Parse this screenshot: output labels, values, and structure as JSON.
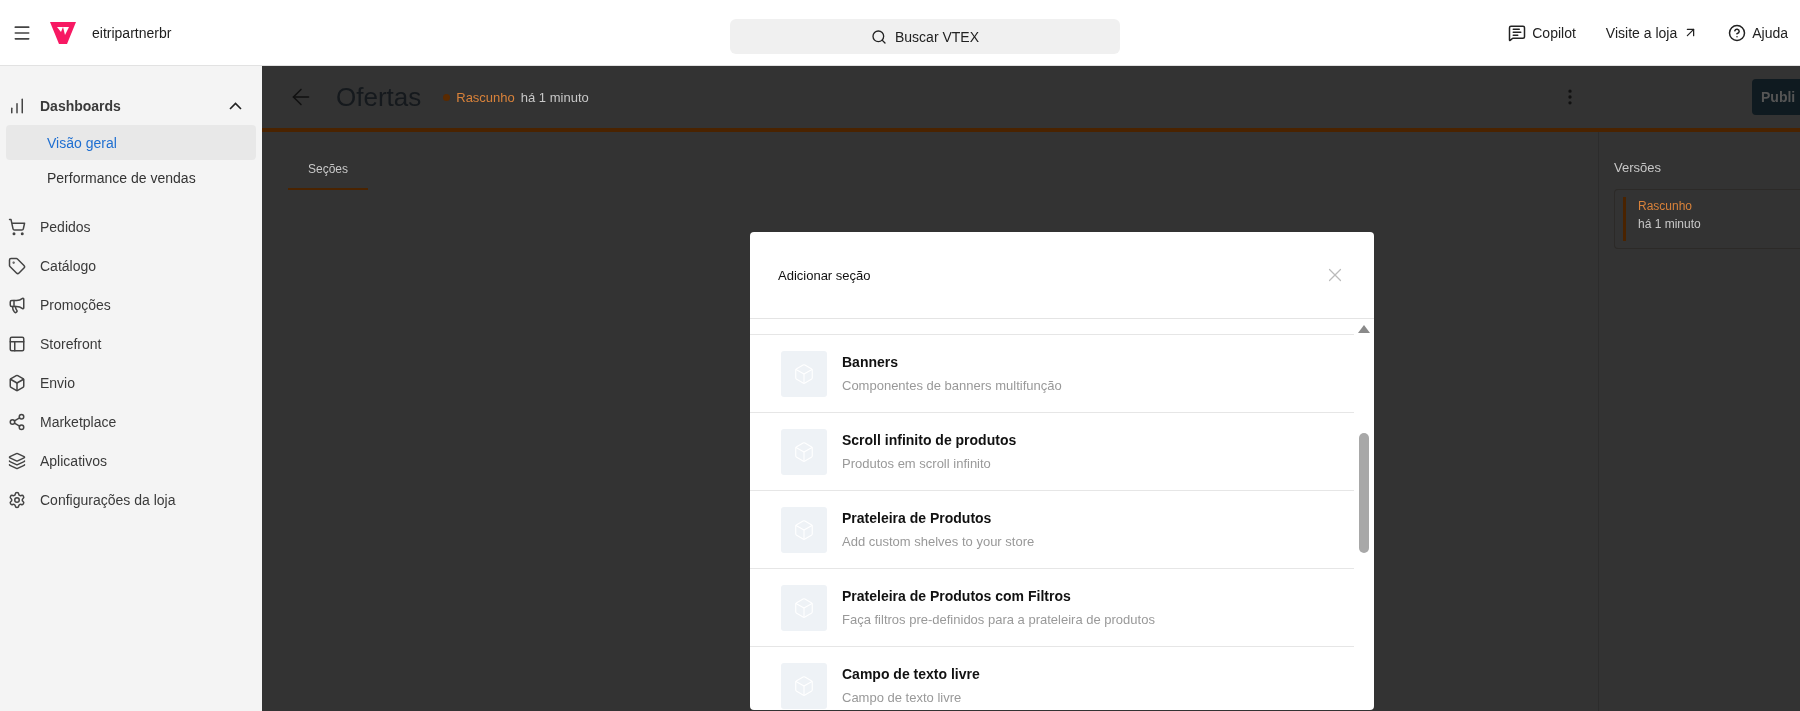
{
  "topbar": {
    "brand": "eitripartnerbr",
    "search": {
      "placeholder": "Buscar VTEX"
    },
    "actions": [
      {
        "label": "Copilot",
        "kind": "chat"
      },
      {
        "label": "Visite a loja",
        "kind": "external"
      },
      {
        "label": "Ajuda",
        "kind": "help"
      }
    ]
  },
  "sidebar": {
    "items": [
      {
        "label": "Dashboards",
        "expanded": true,
        "children": [
          {
            "label": "Visão geral",
            "selected": true
          },
          {
            "label": "Performance de vendas",
            "selected": false
          }
        ]
      },
      {
        "label": "Pedidos"
      },
      {
        "label": "Catálogo"
      },
      {
        "label": "Promoções"
      },
      {
        "label": "Storefront"
      },
      {
        "label": "Envio"
      },
      {
        "label": "Marketplace"
      },
      {
        "label": "Aplicativos"
      },
      {
        "label": "Configurações da loja"
      }
    ]
  },
  "editor": {
    "title": "Ofertas",
    "status": "Rascunho",
    "status_time": "há 1 minuto",
    "publish_button": "Publi",
    "tabs": [
      {
        "label": "Seções",
        "selected": true
      }
    ],
    "versions": {
      "title": "Versões",
      "items": [
        {
          "status": "Rascunho",
          "time": "há 1 minuto",
          "selected": true
        }
      ]
    }
  },
  "modal": {
    "title": "Adicionar seção",
    "items": [
      {
        "title": "Banners",
        "description": "Componentes de banners multifunção"
      },
      {
        "title": "Scroll infinito de produtos",
        "description": "Produtos em scroll infinito"
      },
      {
        "title": "Prateleira de Produtos",
        "description": "Add custom shelves to your store"
      },
      {
        "title": "Prateleira de Produtos com Filtros",
        "description": "Faça filtros pre-definidos para a prateleira de produtos"
      },
      {
        "title": "Campo de texto livre",
        "description": "Campo de texto livre"
      }
    ]
  }
}
